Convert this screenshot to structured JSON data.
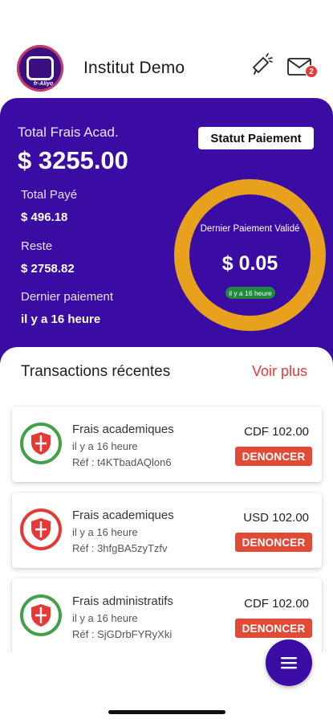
{
  "header": {
    "logo_text": "fr-Aliyo",
    "institute_name": "Institut Demo",
    "notification_count": "2"
  },
  "summary": {
    "total_label": "Total Frais Acad.",
    "total_value": "$ 3255.00",
    "paid_label": "Total Payé",
    "paid_value": "$ 496.18",
    "remaining_label": "Reste",
    "remaining_value": "$ 2758.82",
    "last_payment_label": "Dernier paiement",
    "last_payment_value": "il y a 16 heure",
    "status_button_label": "Statut Paiement",
    "ring": {
      "title": "Dernier Paiement Validé",
      "value": "$ 0.05",
      "badge": "il y a 16 heure"
    },
    "colors": {
      "primary": "#3a0ca3",
      "ring": "#e8a11c",
      "badge": "#1f8a3b"
    }
  },
  "transactions": {
    "title": "Transactions récentes",
    "see_more": "Voir plus",
    "items": [
      {
        "name": "Frais academiques",
        "time": "il y a 16 heure",
        "ref": "Réf : t4KTbadAQlon6",
        "amount": "CDF 102.00",
        "action": "DENONCER",
        "status_color": "#43a047",
        "icon": "shield-icon"
      },
      {
        "name": "Frais academiques",
        "time": "il y a 16 heure",
        "ref": "Réf : 3hfgBA5zyTzfv",
        "amount": "USD 102.00",
        "action": "DENONCER",
        "status_color": "#e53935",
        "icon": "shield-icon"
      },
      {
        "name": "Frais administratifs",
        "time": "il y a 16 heure",
        "ref": "Réf : SjGDrbFYRyXki",
        "amount": "CDF 102.00",
        "action": "DENONCER",
        "status_color": "#43a047",
        "icon": "shield-icon"
      }
    ]
  }
}
